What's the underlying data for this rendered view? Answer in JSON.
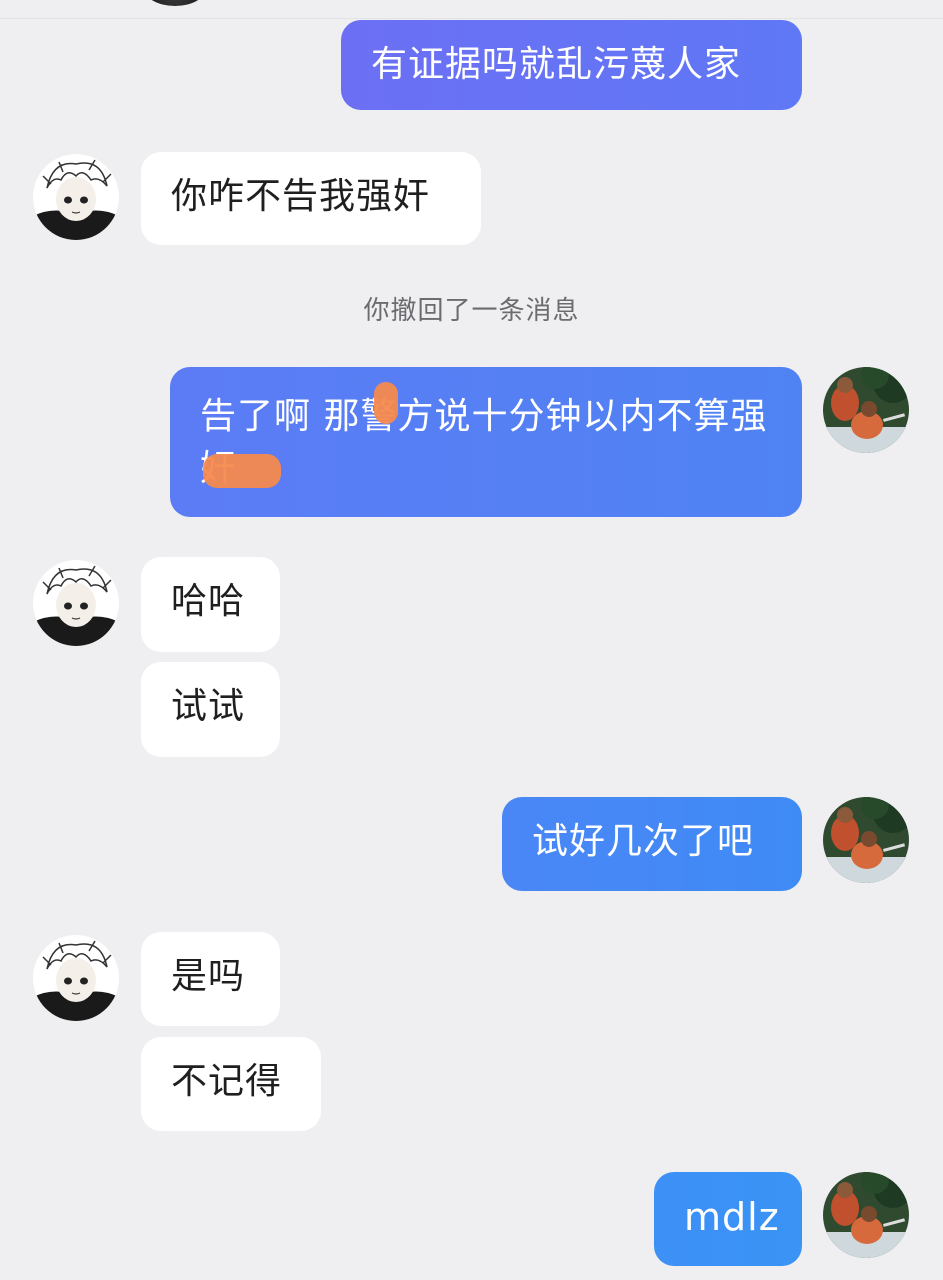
{
  "system_note": "你撤回了一条消息",
  "messages": [
    {
      "side": "out",
      "text": "有证据吗就乱污蔑人家"
    },
    {
      "side": "in",
      "text": "你咋不告我强奸"
    },
    {
      "side": "out",
      "text": "告了啊 那警方说十分钟以内不算强奸"
    },
    {
      "side": "in",
      "text": "哈哈"
    },
    {
      "side": "in",
      "text": "试试"
    },
    {
      "side": "out",
      "text": "试好几次了吧"
    },
    {
      "side": "in",
      "text": "是吗"
    },
    {
      "side": "in",
      "text": "不记得"
    },
    {
      "side": "out",
      "text": "mdlz"
    }
  ],
  "avatars": {
    "contact": "anime-boy-white-hair",
    "self": "two-men-outdoors-photo"
  },
  "colors": {
    "background": "#efeff1",
    "incoming_bubble": "#ffffff",
    "outgoing_bubble_top": "#6c6ff4",
    "outgoing_bubble_bottom": "#3a93f5",
    "redaction_mark": "#f58a4e"
  }
}
